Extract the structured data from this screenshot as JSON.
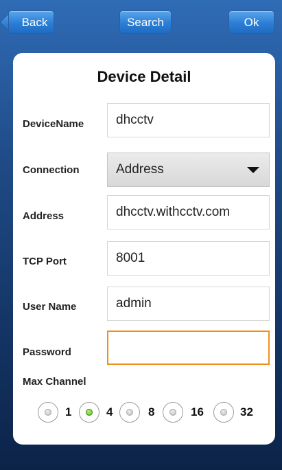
{
  "toolbar": {
    "back_label": "Back",
    "search_label": "Search",
    "ok_label": "Ok"
  },
  "form": {
    "title": "Device Detail",
    "device_name": {
      "label": "DeviceName",
      "value": "dhcctv"
    },
    "connection": {
      "label": "Connection",
      "value": "Address"
    },
    "address": {
      "label": "Address",
      "value": "dhcctv.withcctv.com"
    },
    "tcp_port": {
      "label": "TCP Port",
      "value": "8001"
    },
    "user_name": {
      "label": "User Name",
      "value": "admin"
    },
    "password": {
      "label": "Password",
      "value": ""
    },
    "max_channel": {
      "label": "Max Channel",
      "options": [
        "1",
        "4",
        "8",
        "16",
        "32"
      ],
      "selected": "4"
    }
  },
  "colors": {
    "button_blue": "#2c7fd6",
    "focus_orange": "#ef8f1c",
    "radio_selected_green": "#57b81a"
  }
}
